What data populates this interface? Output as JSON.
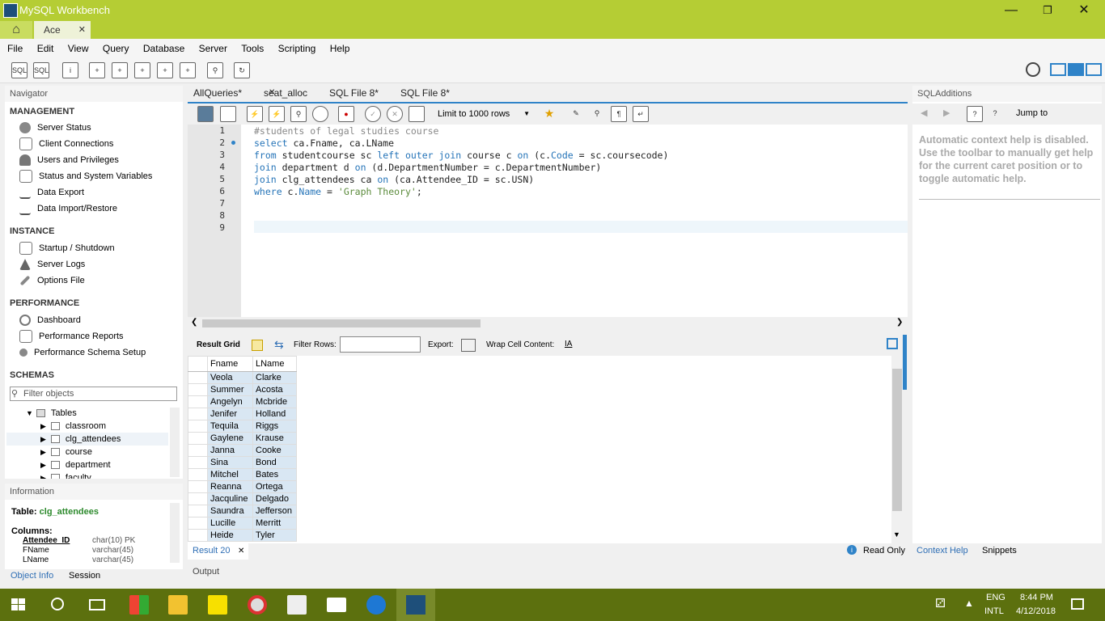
{
  "window": {
    "title": "MySQL Workbench"
  },
  "tabs": {
    "home": "home-icon",
    "active_tab": "Ace"
  },
  "menu": [
    "File",
    "Edit",
    "View",
    "Query",
    "Database",
    "Server",
    "Tools",
    "Scripting",
    "Help"
  ],
  "navigator": {
    "title": "Navigator",
    "management": {
      "label": "MANAGEMENT",
      "items": [
        "Server Status",
        "Client Connections",
        "Users and Privileges",
        "Status and System Variables",
        "Data Export",
        "Data Import/Restore"
      ]
    },
    "instance": {
      "label": "INSTANCE",
      "items": [
        "Startup / Shutdown",
        "Server Logs",
        "Options File"
      ]
    },
    "performance": {
      "label": "PERFORMANCE",
      "items": [
        "Dashboard",
        "Performance Reports",
        "Performance Schema Setup"
      ]
    },
    "schemas": {
      "label": "SCHEMAS",
      "filter_placeholder": "Filter objects",
      "tables_label": "Tables",
      "tables": [
        "classroom",
        "clg_attendees",
        "course",
        "department",
        "faculty"
      ]
    }
  },
  "information": {
    "title": "Information",
    "table_prefix": "Table:",
    "table_name": "clg_attendees",
    "columns_label": "Columns:",
    "columns": [
      {
        "name": "Attendee_ID",
        "type": "char(10) PK"
      },
      {
        "name": "FName",
        "type": "varchar(45)"
      },
      {
        "name": "LName",
        "type": "varchar(45)"
      }
    ],
    "tabs": [
      "Object Info",
      "Session"
    ]
  },
  "editor": {
    "tabs": [
      "AllQueries*",
      "seat_alloc",
      "SQL File 8*",
      "SQL File 8*"
    ],
    "active_tab": 1,
    "limit": "Limit to 1000 rows",
    "line_numbers": [
      "1",
      "2",
      "3",
      "4",
      "5",
      "6",
      "7",
      "8",
      "9"
    ],
    "lines": {
      "l1": "#students of legal studies course",
      "l2a": "select",
      "l2b": " ca.Fname, ca.LName",
      "l3a": "from",
      "l3b": " studentcourse sc ",
      "l3c": "left outer join",
      "l3d": " course c ",
      "l3e": "on",
      "l3f": " (c.",
      "l3g": "Code",
      "l3h": " = sc.coursecode)",
      "l4a": "join",
      "l4b": " department d ",
      "l4c": "on",
      "l4d": " (d.DepartmentNumber = c.DepartmentNumber)",
      "l5a": "join",
      "l5b": " clg_attendees ca ",
      "l5c": "on",
      "l5d": " (ca.Attendee_ID = sc.USN)",
      "l6a": "where",
      "l6b": " c.",
      "l6c": "Name",
      "l6d": " = ",
      "l6e": "'Graph Theory'",
      "l6f": ";"
    }
  },
  "results": {
    "result_grid_label": "Result Grid",
    "filter_label": "Filter Rows:",
    "export_label": "Export:",
    "wrap_label": "Wrap Cell Content:",
    "headers": [
      "Fname",
      "LName"
    ],
    "rows": [
      [
        "Veola",
        "Clarke"
      ],
      [
        "Summer",
        "Acosta"
      ],
      [
        "Angelyn",
        "Mcbride"
      ],
      [
        "Jenifer",
        "Holland"
      ],
      [
        "Tequila",
        "Riggs"
      ],
      [
        "Gaylene",
        "Krause"
      ],
      [
        "Janna",
        "Cooke"
      ],
      [
        "Sina",
        "Bond"
      ],
      [
        "Mitchel",
        "Bates"
      ],
      [
        "Reanna",
        "Ortega"
      ],
      [
        "Jacquline",
        "Delgado"
      ],
      [
        "Saundra",
        "Jefferson"
      ],
      [
        "Lucille",
        "Merritt"
      ],
      [
        "Heide",
        "Tyler"
      ]
    ],
    "result_tab": "Result 20",
    "read_only": "Read Only",
    "output_label": "Output"
  },
  "sql_additions": {
    "title": "SQLAdditions",
    "jump_to": "Jump to",
    "help_text": "Automatic context help is disabled. Use the toolbar to manually get help for the current caret position or to toggle automatic help.",
    "tabs": [
      "Context Help",
      "Snippets"
    ]
  },
  "taskbar": {
    "lang": "ENG",
    "lang2": "INTL",
    "time": "8:44 PM",
    "date": "4/12/2018"
  },
  "colors": {
    "accent_green": "#b5cd34",
    "taskbar": "#5c700e",
    "selection_blue": "#2f83c8",
    "keyword_blue": "#2574b8"
  }
}
